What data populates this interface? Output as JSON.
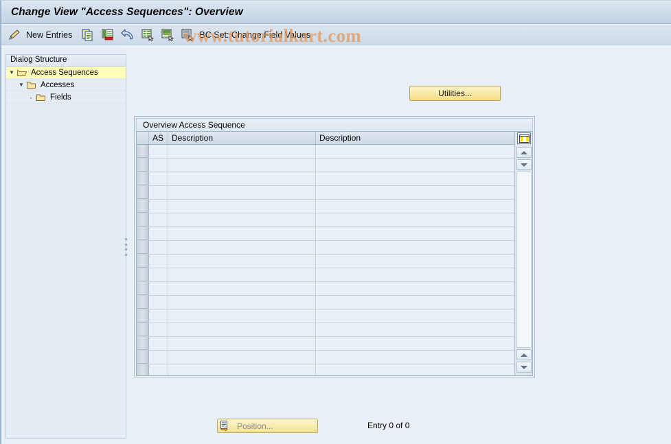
{
  "window": {
    "title": "Change View \"Access Sequences\": Overview"
  },
  "toolbar": {
    "edit_icon": "pencil-icon",
    "new_entries_label": "New Entries",
    "copy_icon": "copy-icon",
    "delete_icon": "delete-icon",
    "undo_icon": "undo-icon",
    "variant1_icon": "select-layout-icon",
    "variant2_icon": "display-variant-icon",
    "variant3_icon": "detail-list-icon",
    "bcset_label": "BC Set: Change Field Values"
  },
  "watermark": {
    "text": "www.tutorialkart.com",
    "color": "#e29456"
  },
  "sidebar": {
    "header": "Dialog Structure",
    "items": [
      {
        "label": "Access Sequences",
        "icon": "open-folder-icon",
        "twisty": "▼",
        "level": 0,
        "selected": true
      },
      {
        "label": "Accesses",
        "icon": "folder-icon",
        "twisty": "▼",
        "level": 1,
        "selected": false
      },
      {
        "label": "Fields",
        "icon": "folder-icon",
        "twisty": "·",
        "level": 2,
        "selected": false
      }
    ],
    "selected_color": "#ffffbb"
  },
  "main": {
    "utilities_label": "Utilities...",
    "panel_title": "Overview Access Sequence",
    "columns": [
      {
        "key": "sel",
        "label": ""
      },
      {
        "key": "as",
        "label": "AS"
      },
      {
        "key": "desc1",
        "label": "Description"
      },
      {
        "key": "desc2",
        "label": "Description"
      }
    ],
    "rows": [
      {
        "as": "",
        "desc1": "",
        "desc2": ""
      },
      {
        "as": "",
        "desc1": "",
        "desc2": ""
      },
      {
        "as": "",
        "desc1": "",
        "desc2": ""
      },
      {
        "as": "",
        "desc1": "",
        "desc2": ""
      },
      {
        "as": "",
        "desc1": "",
        "desc2": ""
      },
      {
        "as": "",
        "desc1": "",
        "desc2": ""
      },
      {
        "as": "",
        "desc1": "",
        "desc2": ""
      },
      {
        "as": "",
        "desc1": "",
        "desc2": ""
      },
      {
        "as": "",
        "desc1": "",
        "desc2": ""
      },
      {
        "as": "",
        "desc1": "",
        "desc2": ""
      },
      {
        "as": "",
        "desc1": "",
        "desc2": ""
      },
      {
        "as": "",
        "desc1": "",
        "desc2": ""
      },
      {
        "as": "",
        "desc1": "",
        "desc2": ""
      },
      {
        "as": "",
        "desc1": "",
        "desc2": ""
      },
      {
        "as": "",
        "desc1": "",
        "desc2": ""
      },
      {
        "as": "",
        "desc1": "",
        "desc2": ""
      },
      {
        "as": "",
        "desc1": "",
        "desc2": ""
      }
    ],
    "column_config_icon": "table-settings-icon",
    "scroll_up_icon": "scroll-up-icon",
    "scroll_down_icon": "scroll-down-icon"
  },
  "footer": {
    "position_label": "Position...",
    "position_icon": "position-icon",
    "entry_count": "Entry 0 of 0"
  }
}
